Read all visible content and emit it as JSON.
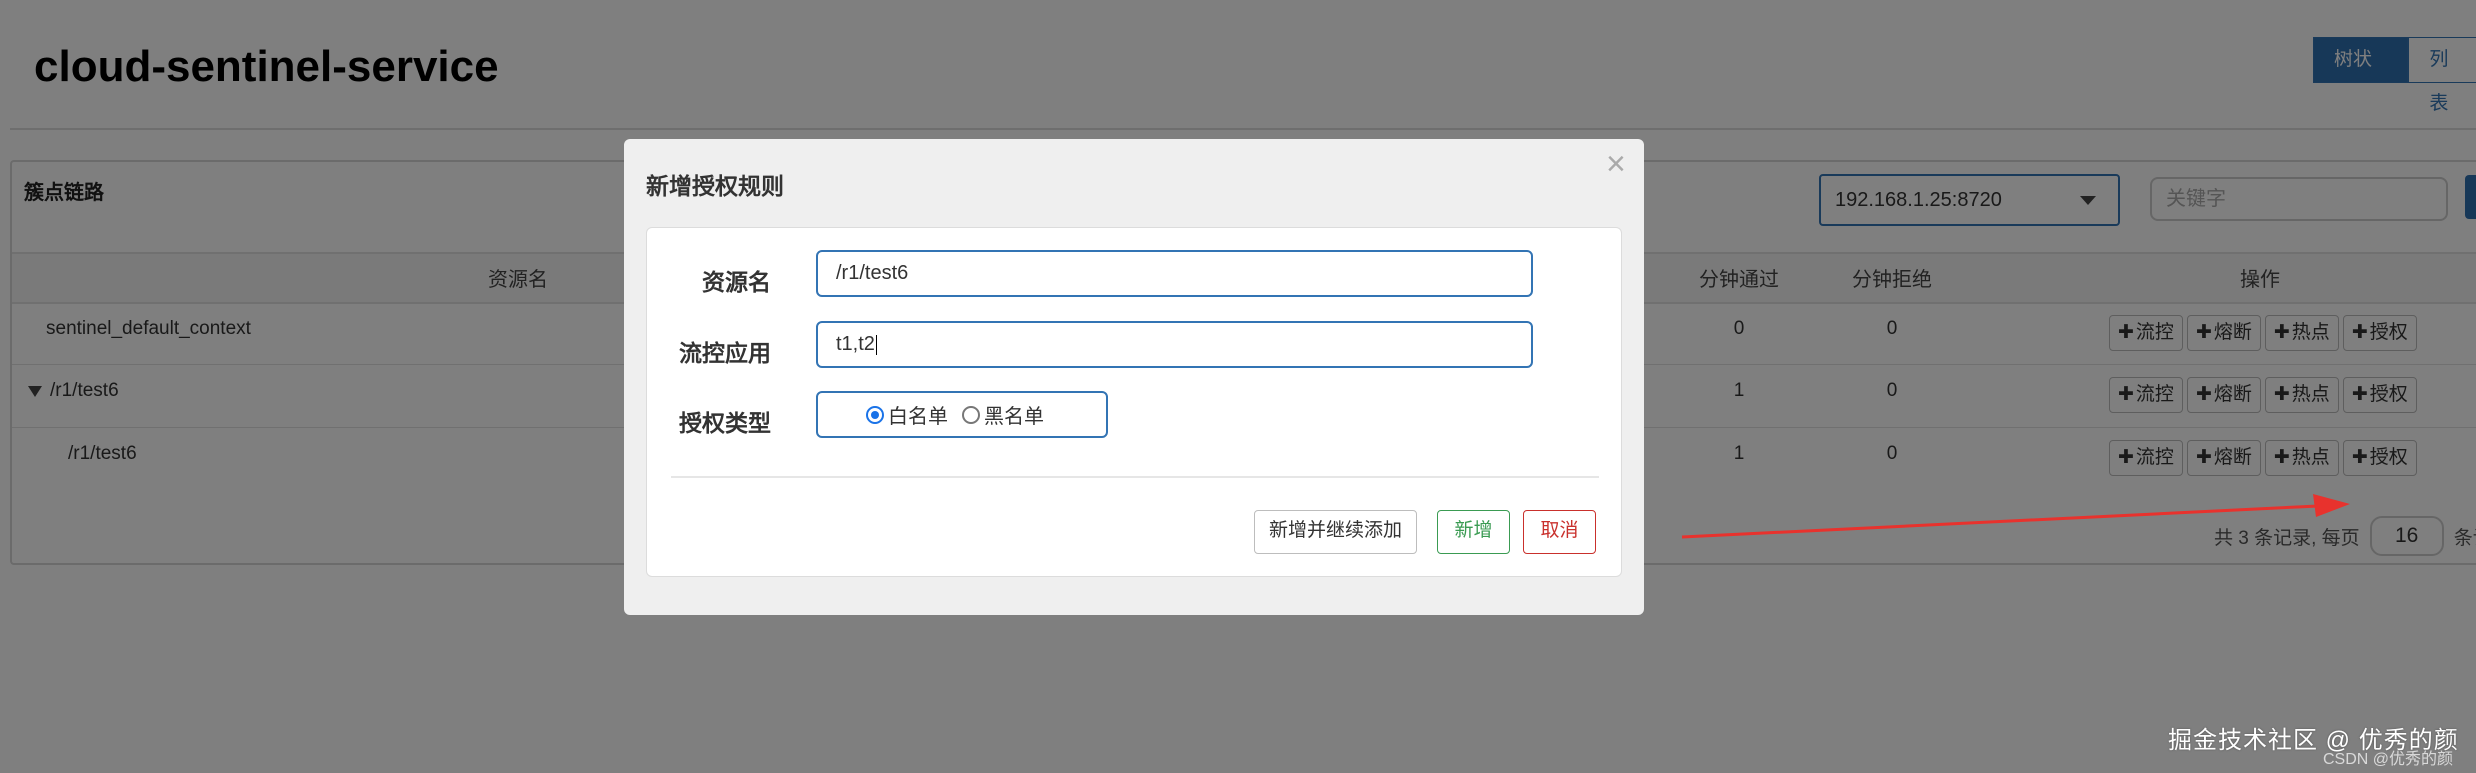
{
  "app": {
    "title": "cloud-sentinel-service",
    "view_toggle": {
      "tree_label": "树状视图",
      "list_label": "列表"
    }
  },
  "panel": {
    "title": "簇点链路",
    "machine_select_value": "192.168.1.25:8720",
    "keyword_placeholder": "关键字"
  },
  "table": {
    "headers": {
      "resource": "资源名",
      "pass_qps": "分钟通过",
      "block_qps": "分钟拒绝",
      "ops": "操作"
    },
    "rows": [
      {
        "resource": "sentinel_default_context",
        "pass": "0",
        "block": "0"
      },
      {
        "resource": "/r1/test6",
        "pass": "1",
        "block": "0"
      },
      {
        "resource": "/r1/test6",
        "pass": "1",
        "block": "0"
      }
    ],
    "op_labels": {
      "flow": "流控",
      "degrade": "熔断",
      "hotspot": "热点",
      "authority": "授权"
    }
  },
  "pager": {
    "summary": "共 3 条记录, 每页",
    "page_size": "16",
    "suffix": "条记"
  },
  "modal": {
    "title": "新增授权规则",
    "close": "×",
    "resource_label": "资源名",
    "resource_value": "/r1/test6",
    "app_label": "流控应用",
    "app_value": "t1,t2",
    "type_label": "授权类型",
    "whitelist_label": "白名单",
    "blacklist_label": "黑名单",
    "btn_add_continue": "新增并继续添加",
    "btn_add": "新增",
    "btn_cancel": "取消"
  },
  "watermark": {
    "main": "掘金技术社区 @ 优秀的颜",
    "sub": "CSDN @优秀的颜"
  },
  "colors": {
    "primary": "#2f70b1",
    "success": "#3a9b52",
    "danger": "#c9302c",
    "arrow": "#e8322d"
  }
}
